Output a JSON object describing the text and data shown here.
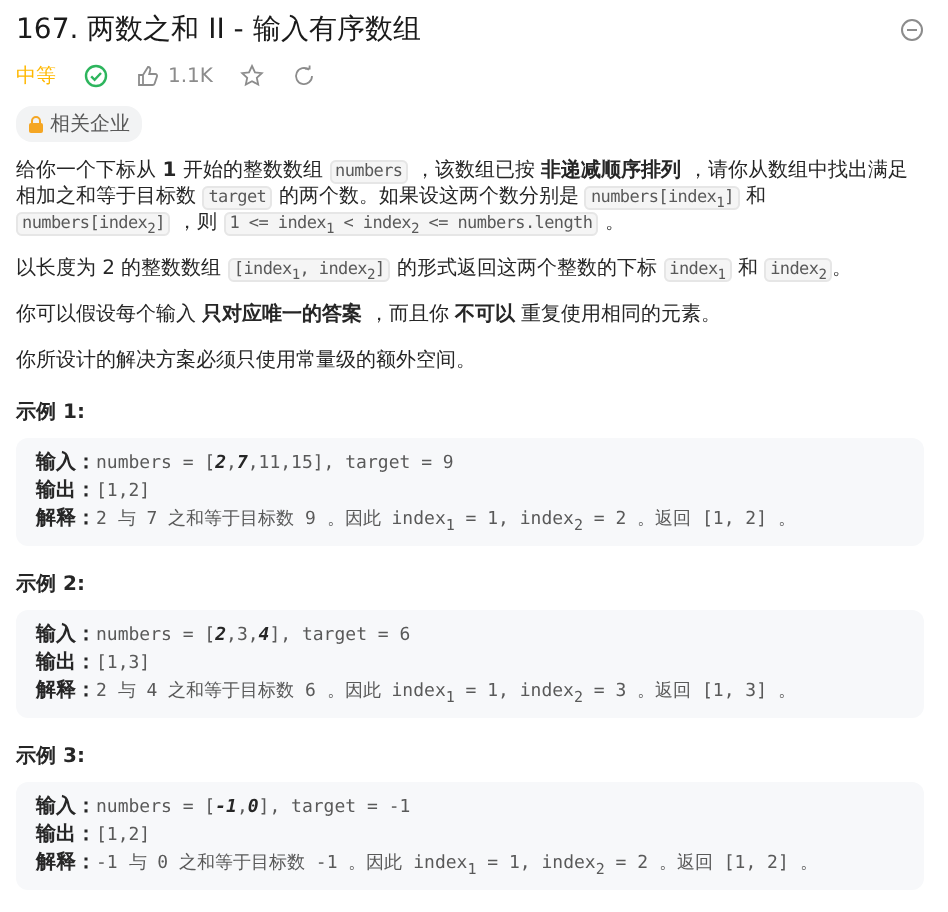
{
  "title": "167. 两数之和 II - 输入有序数组",
  "meta": {
    "difficulty": "中等",
    "solved": true,
    "likes": "1.1K"
  },
  "tag": "相关企业",
  "paragraphs": [
    [
      {
        "kind": "text",
        "text": "给你一个下标从 **1** 开始的整数数组 "
      },
      {
        "kind": "code",
        "text": "numbers"
      },
      {
        "kind": "text",
        "text": " ，该数组已按 **非递减顺序排列** ，请你从数组中找出满足相加之和等于目标数 "
      },
      {
        "kind": "code",
        "text": "target"
      },
      {
        "kind": "text",
        "text": " 的两个数。如果设这两个数分别是 "
      },
      {
        "kind": "code",
        "text": "numbers[index$_{1}$]"
      },
      {
        "kind": "text",
        "text": " 和 "
      },
      {
        "kind": "code",
        "text": "numbers[index$_{2}$]"
      },
      {
        "kind": "text",
        "text": " ，则 "
      },
      {
        "kind": "code",
        "text": "1 <= index$_{1}$ < index$_{2}$ <= numbers.length"
      },
      {
        "kind": "text",
        "text": " 。"
      }
    ],
    [
      {
        "kind": "text",
        "text": "以长度为 2 的整数数组 "
      },
      {
        "kind": "code",
        "text": "[index$_{1}$, index$_{2}$]"
      },
      {
        "kind": "text",
        "text": " 的形式返回这两个整数的下标 "
      },
      {
        "kind": "code",
        "text": "index$_{1}$"
      },
      {
        "kind": "text",
        "text": " 和 "
      },
      {
        "kind": "code",
        "text": "index$_{2}$"
      },
      {
        "kind": "text",
        "text": "。"
      }
    ],
    [
      {
        "kind": "text",
        "text": "你可以假设每个输入 **只对应唯一的答案** ，而且你 **不可以** 重复使用相同的元素。"
      }
    ],
    [
      {
        "kind": "text",
        "text": "你所设计的解决方案必须只使用常量级的额外空间。"
      }
    ]
  ],
  "examples": [
    {
      "heading": "示例 1:",
      "lines": [
        {
          "label": "输入：",
          "value": "numbers = [**2**,**7**,11,15], target = 9"
        },
        {
          "label": "输出：",
          "value": "[1,2]"
        },
        {
          "label": "解释：",
          "value": "2 与 7 之和等于目标数 9 。因此 index$_{1}$ = 1, index$_{2}$ = 2 。返回 [1, 2] 。"
        }
      ]
    },
    {
      "heading": "示例 2:",
      "lines": [
        {
          "label": "输入：",
          "value": "numbers = [**2**,3,**4**], target = 6"
        },
        {
          "label": "输出：",
          "value": "[1,3]"
        },
        {
          "label": "解释：",
          "value": "2 与 4 之和等于目标数 6 。因此 index$_{1}$ = 1, index$_{2}$ = 3 。返回 [1, 3] 。"
        }
      ]
    },
    {
      "heading": "示例 3:",
      "lines": [
        {
          "label": "输入：",
          "value": "numbers = [**-1**,**0**], target = -1"
        },
        {
          "label": "输出：",
          "value": "[1,2]"
        },
        {
          "label": "解释：",
          "value": "-1 与 0 之和等于目标数 -1 。因此 index$_{1}$ = 1, index$_{2}$ = 2 。返回 [1, 2] 。"
        }
      ]
    }
  ]
}
